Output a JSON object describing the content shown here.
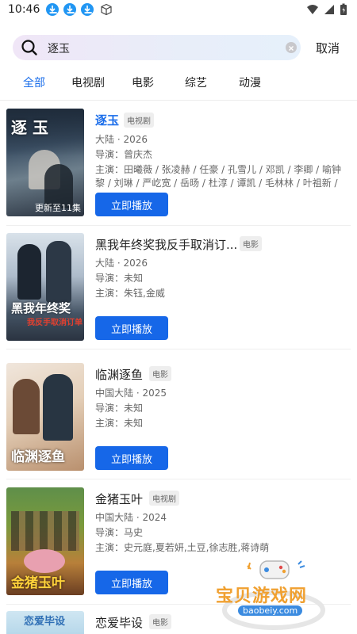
{
  "status": {
    "time": "10:46"
  },
  "search": {
    "query": "逐玉",
    "cancel_label": "取消"
  },
  "tabs": [
    {
      "label": "全部",
      "active": true
    },
    {
      "label": "电视剧",
      "active": false
    },
    {
      "label": "电影",
      "active": false
    },
    {
      "label": "综艺",
      "active": false
    },
    {
      "label": "动漫",
      "active": false
    }
  ],
  "results": [
    {
      "title": "逐玉",
      "badge": "电视剧",
      "region_year": "大陆 · 2026",
      "director": "导演：曾庆杰",
      "cast": "主演：田曦薇 / 张凌赫 / 任豪 / 孔雪儿 / 邓凯 / 李卿 / 喻钟黎 / 刘琳 / 严屹宽 / 岳旸 / 杜淳 / 谭凯 / 毛林林 / 叶祖新 / ...",
      "poster_caption": "更新至11集",
      "play_label": "立即播放"
    },
    {
      "title": "黑我年终奖我反手取消订...",
      "badge": "电影",
      "region_year": "大陆 · 2026",
      "director": "导演：未知",
      "cast": "主演：朱钰,金威",
      "play_label": "立即播放"
    },
    {
      "title": "临渊逐鱼",
      "badge": "电影",
      "region_year": "中国大陆 · 2025",
      "director": "导演：未知",
      "cast": "主演：未知",
      "play_label": "立即播放"
    },
    {
      "title": "金猪玉叶",
      "badge": "电视剧",
      "region_year": "中国大陆 · 2024",
      "director": "导演：马史",
      "cast": "主演：史元庭,夏若妍,土豆,徐志胜,蒋诗萌",
      "play_label": "立即播放"
    },
    {
      "title": "恋爱毕设",
      "badge": "电影"
    }
  ],
  "watermark": {
    "name": "宝贝游戏网",
    "url": "baobeiy.com"
  },
  "colors": {
    "accent": "#1667e8",
    "active_tab": "#1a6dea"
  }
}
